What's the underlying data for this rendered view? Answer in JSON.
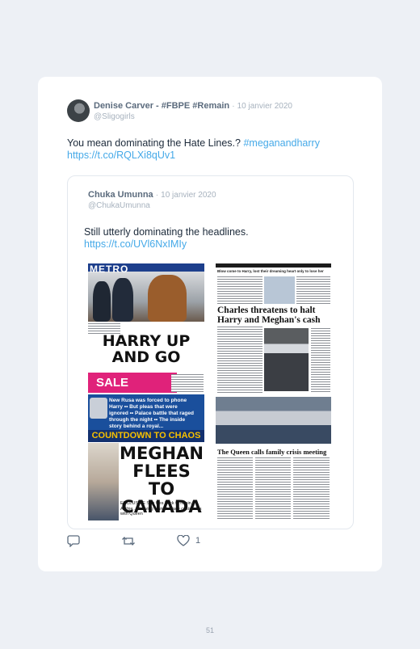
{
  "tweet": {
    "author_name": "Denise Carver - #FBPE #Remain",
    "date": "10 janvier 2020",
    "handle": "@Sligogirls",
    "text": "You mean dominating the Hate Lines.? ",
    "hashtag": "#meganandharry",
    "link": "https://t.co/RQLXi8qUv1"
  },
  "quoted": {
    "author_name": "Chuka Umunna",
    "date": "10 janvier 2020",
    "handle": "@ChukaUmunna",
    "text": "Still utterly dominating the headlines.",
    "link": "https://t.co/UVl6NxIMIy",
    "papers": {
      "metro_masthead": "METRO",
      "metro_headline_1": "HARRY UP",
      "metro_headline_2": "AND GO",
      "sale_text": "SALE",
      "blue_box_text": "New Rusa was forced to phone Harry •• But pleas that were ignored •• Palace battle that raged through the night •• The inside story behind a royal...",
      "countdown": "COUNTDOWN TO CHAOS",
      "headline_3": "MEGHAN FLEES TO CANADA",
      "exclusive": "EXCLUSIVE She flies back to rejoin Archie ... leaving Harry to face crisis talks with Queen",
      "times_topline": "Blow come to Harry, lost their dreaming heart only to lose her",
      "times_headline": "Charles threatens to halt Harry and Meghan's cash",
      "times_headline_2": "The Queen calls family crisis meeting"
    }
  },
  "actions": {
    "reply_icon": "reply-icon",
    "retweet_icon": "retweet-icon",
    "like_icon": "heart-icon",
    "like_count": "1"
  },
  "page_number": "51"
}
